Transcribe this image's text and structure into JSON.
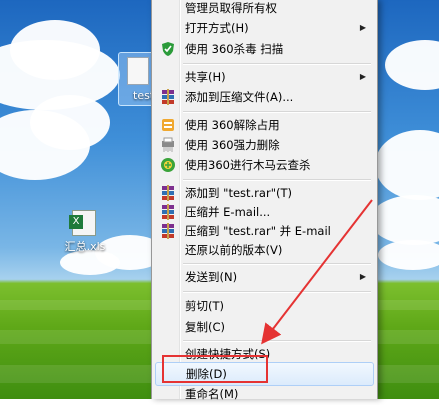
{
  "desktop": {
    "selected_file_label": "test",
    "excel_file_label": "汇总.xls"
  },
  "context_menu": {
    "items": [
      {
        "label": "管理员取得所有权",
        "icon": "none"
      },
      {
        "label": "打开方式(H)",
        "icon": "none",
        "submenu": true
      },
      {
        "label": "使用 360杀毒 扫描",
        "icon": "360-antivirus-icon"
      },
      {
        "label": "共享(H)",
        "icon": "none",
        "submenu": true
      },
      {
        "label": "添加到压缩文件(A)...",
        "icon": "winrar-icon"
      },
      {
        "label": "使用 360解除占用",
        "icon": "360-unlock-icon"
      },
      {
        "label": "使用 360强力删除",
        "icon": "360-shredder-icon"
      },
      {
        "label": "使用360进行木马云查杀",
        "icon": "360-trojan-scan-icon"
      },
      {
        "label": "添加到 \"test.rar\"(T)",
        "icon": "winrar-icon"
      },
      {
        "label": "压缩并 E-mail...",
        "icon": "winrar-icon"
      },
      {
        "label": "压缩到 \"test.rar\" 并 E-mail",
        "icon": "winrar-icon"
      },
      {
        "label": "还原以前的版本(V)",
        "icon": "none"
      },
      {
        "label": "发送到(N)",
        "icon": "none",
        "submenu": true
      },
      {
        "label": "剪切(T)",
        "icon": "none"
      },
      {
        "label": "复制(C)",
        "icon": "none"
      },
      {
        "label": "创建快捷方式(S)",
        "icon": "none"
      },
      {
        "label": "删除(D)",
        "icon": "none",
        "highlighted": true
      },
      {
        "label": "重命名(M)",
        "icon": "none"
      }
    ]
  },
  "annotation_color": "#e53333"
}
